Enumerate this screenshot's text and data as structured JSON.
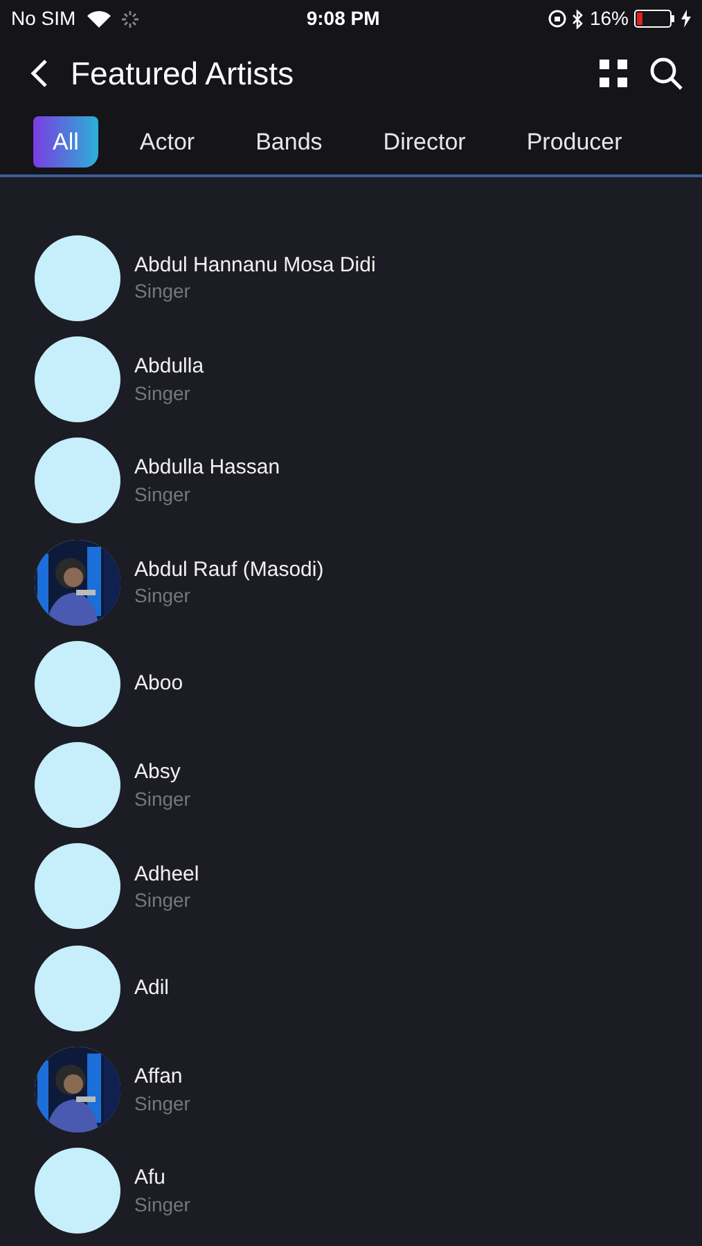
{
  "status_bar": {
    "carrier": "No SIM",
    "time": "9:08 PM",
    "battery_percent": "16%"
  },
  "header": {
    "title": "Featured Artists"
  },
  "tabs": [
    {
      "label": "All",
      "selected": true
    },
    {
      "label": "Actor",
      "selected": false
    },
    {
      "label": "Bands",
      "selected": false
    },
    {
      "label": "Director",
      "selected": false
    },
    {
      "label": "Producer",
      "selected": false
    }
  ],
  "artists": [
    {
      "name": "Abdul Hannanu Mosa Didi",
      "role": "Singer",
      "kind": "blank"
    },
    {
      "name": "Abdulla",
      "role": "Singer",
      "kind": "blank"
    },
    {
      "name": "Abdulla Hassan",
      "role": "Singer",
      "kind": "blank"
    },
    {
      "name": "Abdul Rauf (Masodi)",
      "role": "Singer",
      "kind": "picture"
    },
    {
      "name": "Aboo",
      "kind": "blank"
    },
    {
      "name": "Absy",
      "role": "Singer",
      "kind": "blank"
    },
    {
      "name": "Adheel",
      "role": "Singer",
      "kind": "blank"
    },
    {
      "name": "Adil",
      "kind": "blank"
    },
    {
      "name": "Affan",
      "role": "Singer",
      "kind": "picture"
    },
    {
      "name": "Afu",
      "role": "Singer",
      "kind": "blank"
    }
  ]
}
